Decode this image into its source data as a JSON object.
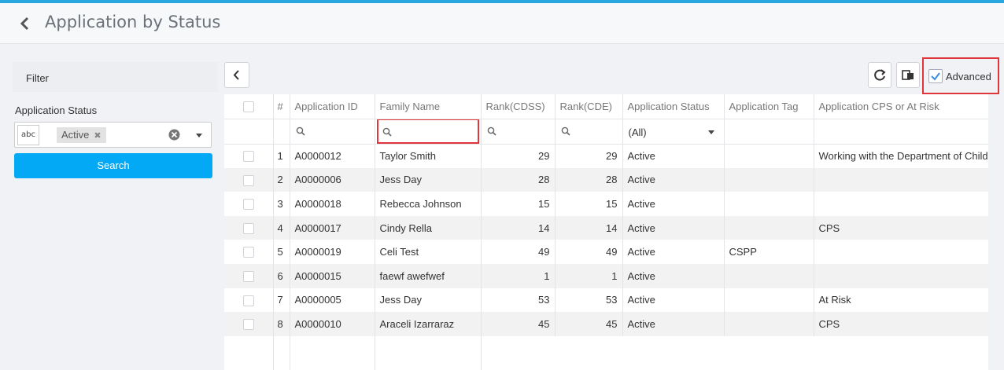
{
  "header": {
    "title": "Application by Status"
  },
  "filter": {
    "heading": "Filter",
    "status_label": "Application Status",
    "type_indicator": "abc",
    "selected_tag": "Active",
    "search_label": "Search"
  },
  "toolbar": {
    "advanced_label": "Advanced",
    "advanced_checked": true
  },
  "grid": {
    "columns": [
      "#",
      "Application ID",
      "Family Name",
      "Rank(CDSS)",
      "Rank(CDE)",
      "Application Status",
      "Application Tag",
      "Application CPS or At Risk"
    ],
    "status_filter_value": "(All)",
    "rows": [
      {
        "n": "1",
        "id": "A0000012",
        "family": "Taylor Smith",
        "cdss": "29",
        "cde": "29",
        "status": "Active",
        "tag": "",
        "cps": "Working with the Department of Children"
      },
      {
        "n": "2",
        "id": "A0000006",
        "family": "Jess Day",
        "cdss": "28",
        "cde": "28",
        "status": "Active",
        "tag": "",
        "cps": ""
      },
      {
        "n": "3",
        "id": "A0000018",
        "family": "Rebecca Johnson",
        "cdss": "15",
        "cde": "15",
        "status": "Active",
        "tag": "",
        "cps": ""
      },
      {
        "n": "4",
        "id": "A0000017",
        "family": "Cindy Rella",
        "cdss": "14",
        "cde": "14",
        "status": "Active",
        "tag": "",
        "cps": "CPS"
      },
      {
        "n": "5",
        "id": "A0000019",
        "family": "Celi Test",
        "cdss": "49",
        "cde": "49",
        "status": "Active",
        "tag": "CSPP",
        "cps": ""
      },
      {
        "n": "6",
        "id": "A0000015",
        "family": "faewf awefwef",
        "cdss": "1",
        "cde": "1",
        "status": "Active",
        "tag": "",
        "cps": ""
      },
      {
        "n": "7",
        "id": "A0000005",
        "family": "Jess Day",
        "cdss": "53",
        "cde": "53",
        "status": "Active",
        "tag": "",
        "cps": "At Risk"
      },
      {
        "n": "8",
        "id": "A0000010",
        "family": "Araceli Izarraraz",
        "cdss": "45",
        "cde": "45",
        "status": "Active",
        "tag": "",
        "cps": "CPS"
      }
    ]
  },
  "colors": {
    "accent": "#03a9f4",
    "topbar": "#29a8e0",
    "highlight": "#e0353a",
    "link": "#3c8dde"
  },
  "icons": [
    "chevron-left-icon",
    "search-icon",
    "clear-icon",
    "refresh-icon",
    "export-icon",
    "checkmark-icon"
  ]
}
